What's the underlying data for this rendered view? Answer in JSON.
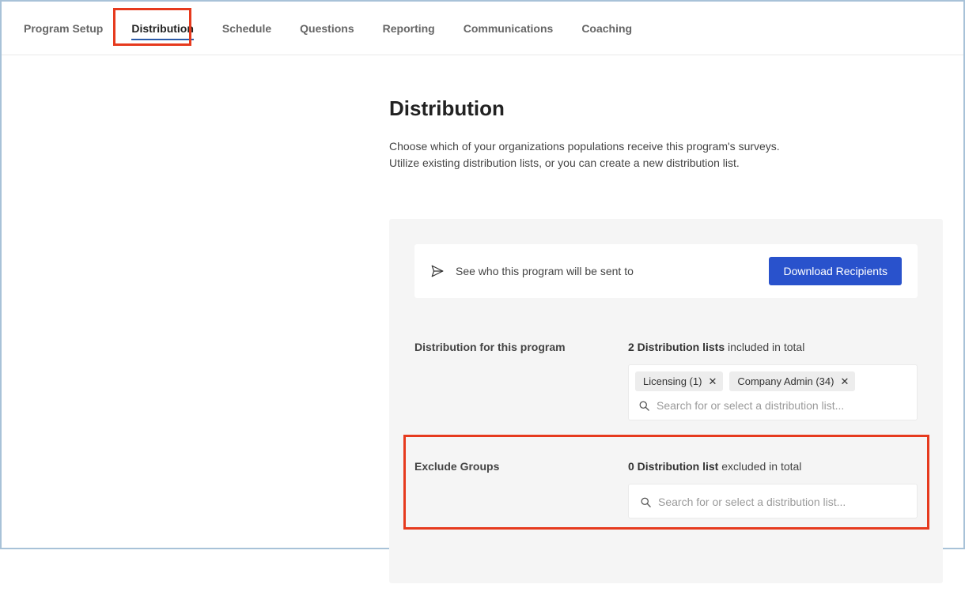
{
  "tabs": {
    "items": [
      {
        "label": "Program Setup"
      },
      {
        "label": "Distribution"
      },
      {
        "label": "Schedule"
      },
      {
        "label": "Questions"
      },
      {
        "label": "Reporting"
      },
      {
        "label": "Communications"
      },
      {
        "label": "Coaching"
      }
    ],
    "active_index": 1
  },
  "page": {
    "title": "Distribution",
    "description_line1": "Choose which of your organizations populations receive this program's surveys.",
    "description_line2": "Utilize existing distribution lists, or you can create a new distribution list."
  },
  "info_bar": {
    "text": "See who this program will be sent to",
    "button": "Download Recipients"
  },
  "included": {
    "section_label": "Distribution for this program",
    "count_prefix": "2 Distribution lists",
    "count_suffix": " included in total",
    "chips": [
      {
        "label": "Licensing (1)"
      },
      {
        "label": "Company Admin (34)"
      }
    ],
    "search_placeholder": "Search for or select a distribution list..."
  },
  "excluded": {
    "section_label": "Exclude Groups",
    "count_prefix": "0 Distribution list",
    "count_suffix": " excluded in total",
    "search_placeholder": "Search for or select a distribution list..."
  }
}
